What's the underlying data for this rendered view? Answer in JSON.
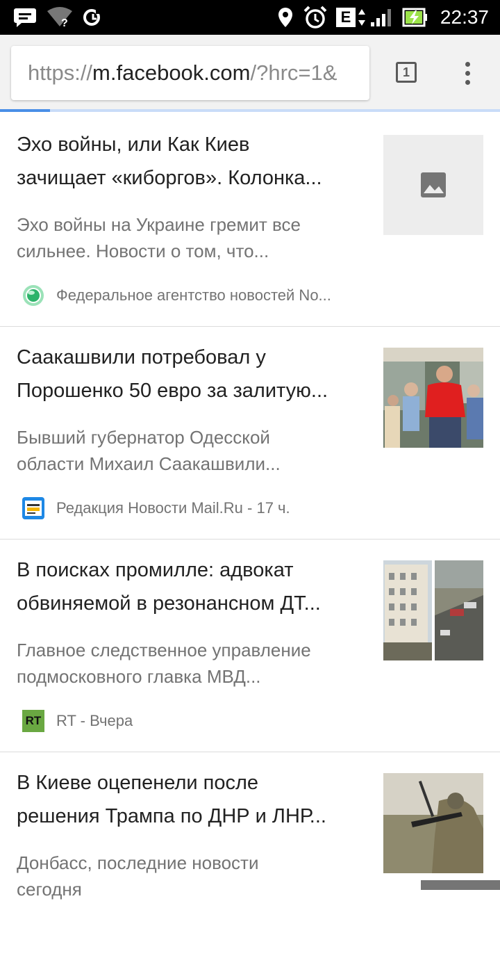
{
  "status_bar": {
    "time": "22:37",
    "icons": [
      "message-icon",
      "wifi-unknown-icon",
      "sync-icon",
      "location-icon",
      "alarm-icon",
      "edge-network-icon",
      "signal-icon",
      "battery-charging-icon"
    ],
    "network_letter": "E",
    "wifi_mark": "?"
  },
  "browser": {
    "url_scheme": "https://",
    "url_host": "m.facebook.com",
    "url_path": "/?hrc=1&",
    "tab_count": "1",
    "load_progress": 0.1
  },
  "articles": [
    {
      "title_lines": [
        "Эхо войны, или Как Киев",
        "зачищает «киборгов». Колонка..."
      ],
      "snippet_lines": [
        "Эхо войны на Украине гремит все",
        "сильнее. Новости о том, что..."
      ],
      "source": "Федеральное агентство новостей No...",
      "favicon": "fan-globe-icon",
      "thumbnail": "image-placeholder-icon"
    },
    {
      "title_lines": [
        "Саакашвили потребовал у",
        "Порошенко 50 евро за залитую..."
      ],
      "snippet_lines": [
        "Бывший губернатор Одесской",
        "области Михаил Саакашвили..."
      ],
      "source": "Редакция Новости Mail.Ru - 17 ч.",
      "favicon": "mailru-news-icon",
      "thumbnail": "photo-people-red-shirt"
    },
    {
      "title_lines": [
        "В поисках промилле: адвокат",
        "обвиняемой в резонансном ДТ..."
      ],
      "snippet_lines": [
        "Главное следственное управление",
        "подмосковного главка МВД..."
      ],
      "source": "RT - Вчера",
      "favicon": "rt-logo-icon",
      "favicon_text": "RT",
      "thumbnail": "photo-street-collage"
    },
    {
      "title_lines": [
        "В Киеве оцепенели после",
        "решения Трампа по ДНР и ЛНР..."
      ],
      "snippet_lines": [
        "Донбасс, последние новости",
        "сегодня"
      ],
      "source": "",
      "favicon": "",
      "thumbnail": "photo-soldier-field"
    }
  ],
  "colors": {
    "status_bar": "#000000",
    "toolbar": "#f2f2f2",
    "progress": "#4a8fe7",
    "title_text": "#212121",
    "secondary_text": "#737373"
  }
}
